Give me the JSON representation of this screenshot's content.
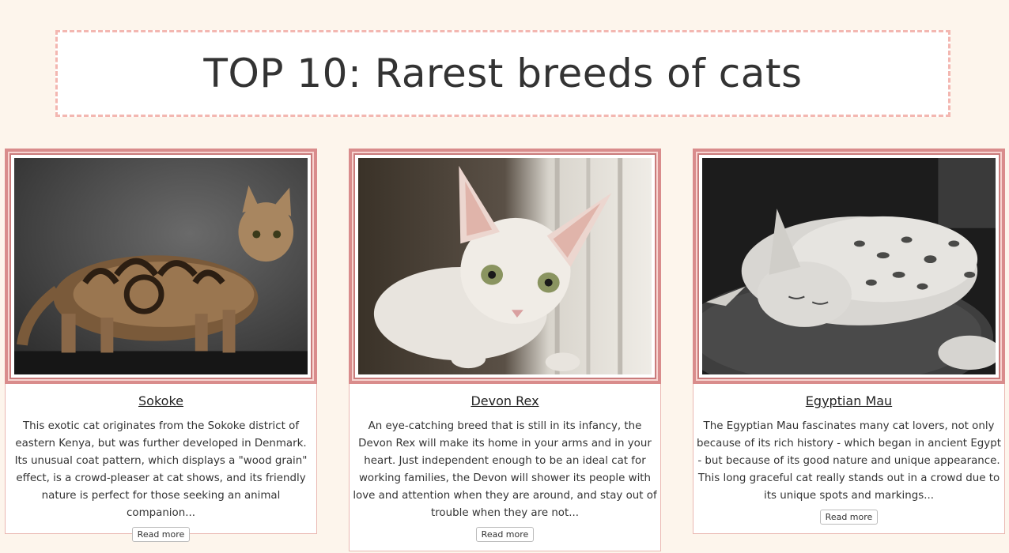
{
  "header": {
    "title": "TOP 10: Rarest breeds of cats"
  },
  "cards": [
    {
      "name": "Sokoke",
      "image": "sokoke-cat-photo",
      "description": "This exotic cat originates from the Sokoke district of eastern Kenya, but was further developed in Denmark. Its unusual coat pattern, which displays a \"wood grain\" effect, is a crowd-pleaser at cat shows, and its friendly nature is perfect for those seeking an animal companion...",
      "button": "Read more"
    },
    {
      "name": "Devon Rex",
      "image": "devon-rex-cat-photo",
      "description": "An eye-catching breed that is still in its infancy, the Devon Rex will make its home in your arms and in your heart. Just independent enough to be an ideal cat for working families, the Devon will shower its people with love and attention when they are around, and stay out of trouble when they are not...",
      "button": "Read more"
    },
    {
      "name": "Egyptian Mau",
      "image": "egyptian-mau-cat-photo",
      "description": "The Egyptian Mau fascinates many cat lovers, not only because of its rich history - which began in ancient Egypt - but because of its good nature and unique appearance. This long graceful cat really stands out in a crowd due to its unique spots and markings...",
      "button": "Read more"
    }
  ],
  "colors": {
    "background": "#fdf5ec",
    "accent_border": "#d98c8c",
    "dashed_border": "#f3b7b1"
  }
}
